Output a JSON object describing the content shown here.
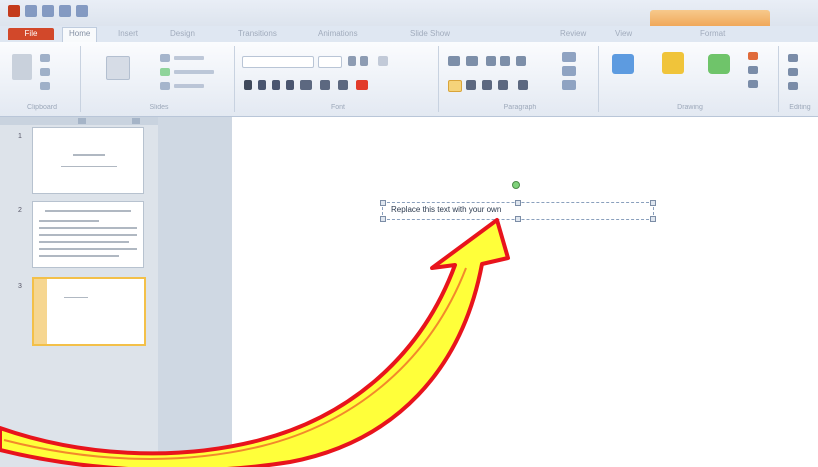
{
  "window": {
    "title": "",
    "file_tab_color": "#d2482a",
    "contextual_tab_color": "#f0a85a"
  },
  "ribbon": {
    "tabs": [
      {
        "label": "File"
      },
      {
        "label": "Home"
      },
      {
        "label": "Insert"
      },
      {
        "label": "Design"
      },
      {
        "label": "Transitions"
      },
      {
        "label": "Animations"
      },
      {
        "label": "Slide Show"
      },
      {
        "label": "Review"
      },
      {
        "label": "View"
      },
      {
        "label": "Format"
      }
    ],
    "groups": [
      {
        "label": "Clipboard"
      },
      {
        "label": "Slides"
      },
      {
        "label": "Font"
      },
      {
        "label": "Paragraph"
      },
      {
        "label": "Drawing"
      },
      {
        "label": "Editing"
      }
    ]
  },
  "slides_pane": {
    "thumbnails": [
      {
        "number": "1"
      },
      {
        "number": "2"
      },
      {
        "number": "3",
        "selected": true
      }
    ]
  },
  "slide": {
    "textbox_text": "Replace this text with your own",
    "selection_color": "#8aa0bd"
  },
  "annotation": {
    "arrow_fill": "#ffff3a",
    "arrow_stroke": "#e8141c"
  }
}
